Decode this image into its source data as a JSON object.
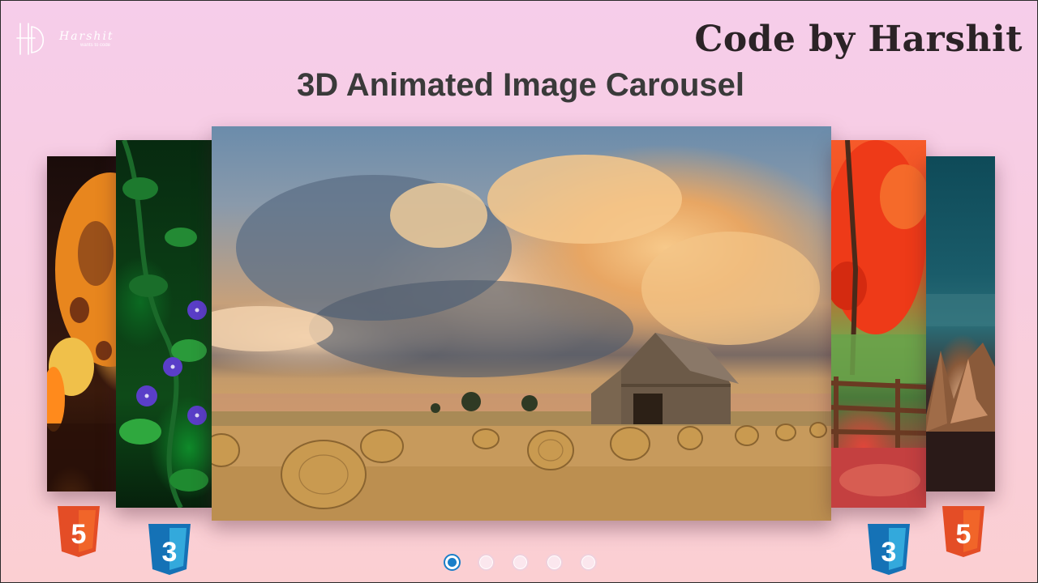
{
  "brand": {
    "name": "Harshit",
    "tagline": "wants to code"
  },
  "byline": "Code by Harshit",
  "title": "3D Animated Image Carousel",
  "carousel": {
    "slides": [
      {
        "subject": "hot air balloon at night"
      },
      {
        "subject": "purple flowers and green leaves"
      },
      {
        "subject": "barn and hay bales under dramatic sunset clouds"
      },
      {
        "subject": "red autumn tree with wooden fence"
      },
      {
        "subject": "teal sky over rock formations"
      }
    ],
    "active_index": 0,
    "dot_count": 5
  },
  "badges": {
    "html5_label": "5",
    "css3_label": "3"
  },
  "colors": {
    "html5": "#e44d26",
    "html5_light": "#f16529",
    "css3": "#1572b6",
    "css3_light": "#33a9dc",
    "dot_active": "#1a7ec8"
  }
}
